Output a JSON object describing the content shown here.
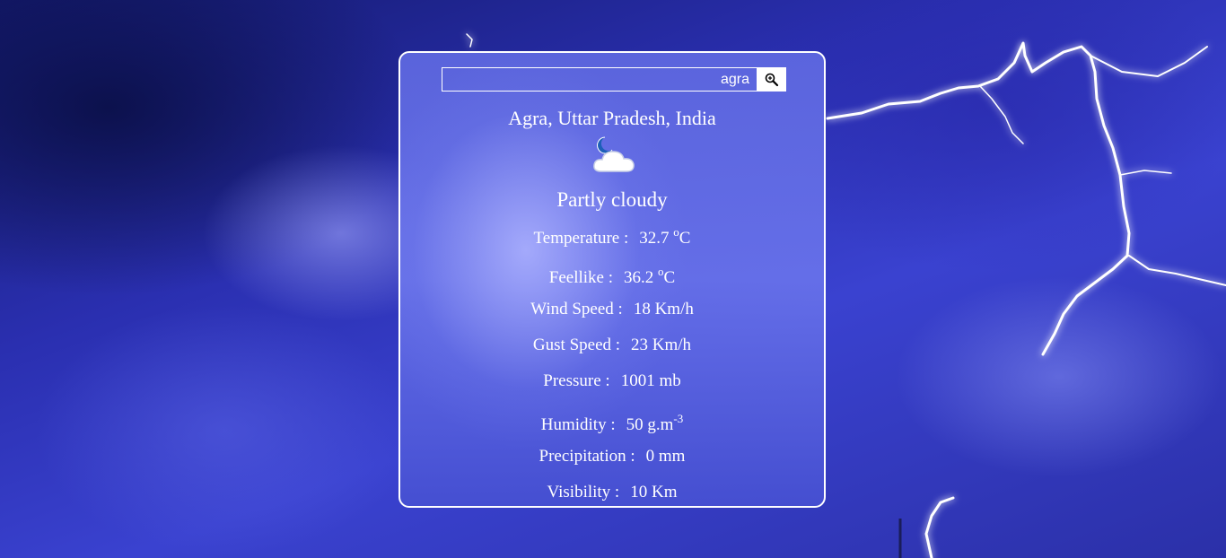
{
  "search": {
    "value": "agra",
    "button_icon": "search-zoom-icon"
  },
  "location": "Agra, Uttar Pradesh, India",
  "icon": "moon-cloud-icon",
  "condition": "Partly cloudy",
  "stats": {
    "temperature": {
      "label": "Temperature :",
      "value": "32.7",
      "unit_sup": "o",
      "unit": "C"
    },
    "feelslike": {
      "label": "Feellike :",
      "value": "36.2",
      "unit_sup": "o",
      "unit": "C"
    },
    "wind": {
      "label": "Wind Speed :",
      "value": "18 Km/h"
    },
    "gust": {
      "label": "Gust Speed :",
      "value": "23 Km/h"
    },
    "pressure": {
      "label": "Pressure :",
      "value": "1001 mb"
    },
    "humidity": {
      "label": "Humidity :",
      "value": "50 g.m",
      "unit_sup": "-3"
    },
    "precipitation": {
      "label": "Precipitation :",
      "value": "0 mm"
    },
    "visibility": {
      "label": "Visibility :",
      "value": "10 Km"
    }
  },
  "colors": {
    "card_border": "#ffffff",
    "text": "#ffffff",
    "lightning": "#ffffff"
  }
}
